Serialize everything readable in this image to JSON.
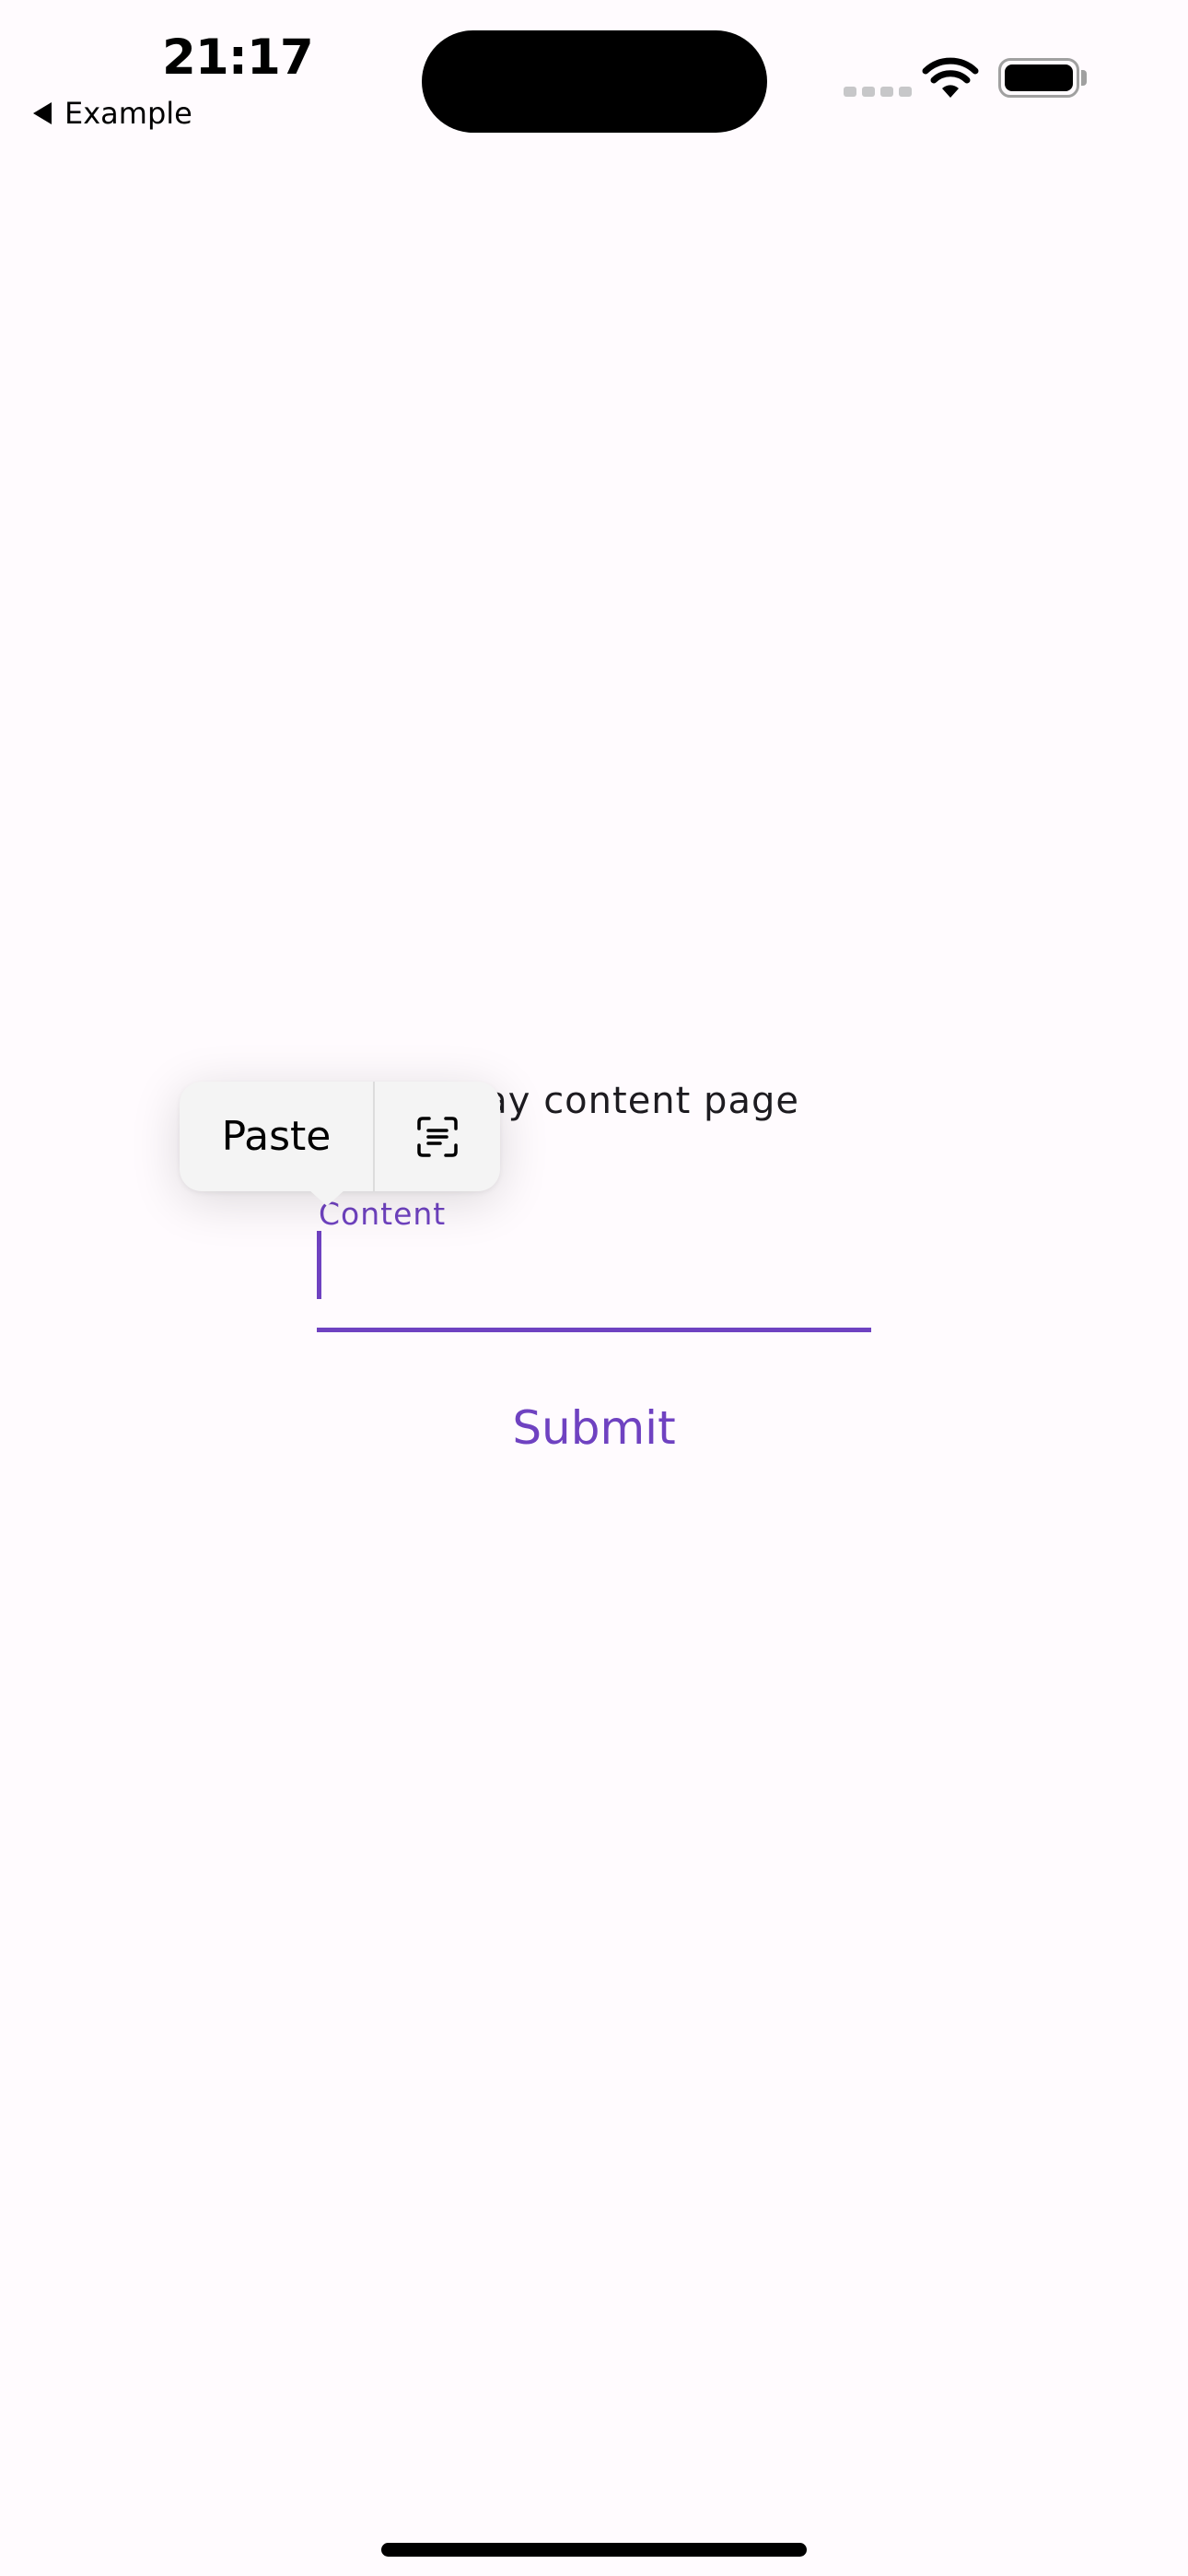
{
  "status_bar": {
    "time": "21:17",
    "back_label": "Example"
  },
  "page": {
    "heading": "Display content page",
    "content_field": {
      "label": "Content",
      "value": ""
    },
    "submit_label": "Submit"
  },
  "edit_menu": {
    "paste_label": "Paste",
    "scan_icon": "scan-text-icon"
  },
  "colors": {
    "accent": "#6f42c1",
    "background": "#fffbfe",
    "menu_background": "#f4f4f4"
  }
}
